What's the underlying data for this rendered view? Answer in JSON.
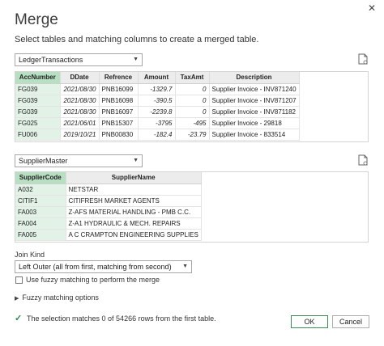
{
  "dialog": {
    "close_glyph": "✕",
    "title": "Merge",
    "subtitle": "Select tables and matching columns to create a merged table."
  },
  "table1": {
    "selected": "LedgerTransactions",
    "columns": [
      "AccNumber",
      "DDate",
      "Refrence",
      "Amount",
      "TaxAmt",
      "Description"
    ],
    "rows": [
      [
        "FG039",
        "2021/08/30",
        "PNB16099",
        "-1329.7",
        "0",
        "Supplier Invoice - INV871240"
      ],
      [
        "FG039",
        "2021/08/30",
        "PNB16098",
        "-390.5",
        "0",
        "Supplier Invoice - INV871207"
      ],
      [
        "FG039",
        "2021/08/30",
        "PNB16097",
        "-2239.8",
        "0",
        "Supplier Invoice - INV871182"
      ],
      [
        "FG025",
        "2021/06/01",
        "PNB15307",
        "-3795",
        "-495",
        "Supplier Invoice - 29818"
      ],
      [
        "FU006",
        "2019/10/21",
        "PNB00830",
        "-182.4",
        "-23.79",
        "Supplier Invoice - 833514"
      ]
    ]
  },
  "table2": {
    "selected": "SupplierMaster",
    "columns": [
      "SupplierCode",
      "SupplierName"
    ],
    "rows": [
      [
        "A032",
        "NETSTAR"
      ],
      [
        "CITIF1",
        "CITIFRESH MARKET AGENTS"
      ],
      [
        "FA003",
        "Z-AFS MATERIAL HANDLING - PMB C.C."
      ],
      [
        "FA004",
        "Z-A1 HYDRAULIC & MECH. REPAIRS"
      ],
      [
        "FA005",
        "A C CRAMPTON ENGINEERING SUPPLIES"
      ]
    ]
  },
  "join": {
    "label": "Join Kind",
    "selected": "Left Outer (all from first, matching from second)"
  },
  "fuzzy": {
    "checkbox_label": "Use fuzzy matching to perform the merge",
    "options_label": "Fuzzy matching options"
  },
  "status": {
    "message": "The selection matches 0 of 54266 rows from the first table."
  },
  "buttons": {
    "ok": "OK",
    "cancel": "Cancel"
  },
  "colors": {
    "selected_header": "#b7dfc2",
    "selected_cell": "#e3f2e7",
    "check": "#2e8b57"
  }
}
